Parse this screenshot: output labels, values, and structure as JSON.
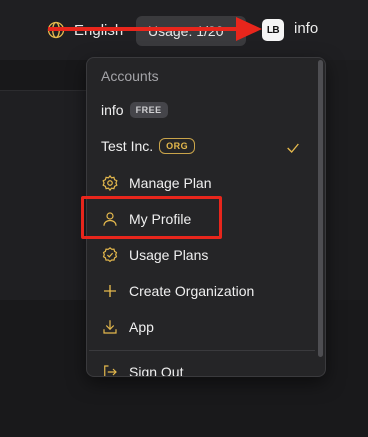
{
  "header": {
    "language_label": "English",
    "usage_label": "Usage: 1/20",
    "avatar_initials": "LB",
    "user_name": "info"
  },
  "menu": {
    "section_title": "Accounts",
    "accounts": [
      {
        "name": "info",
        "badge": "FREE"
      },
      {
        "name": "Test Inc.",
        "badge": "ORG",
        "selected": true
      }
    ],
    "items": [
      {
        "label": "Manage Plan",
        "icon": "gear-icon"
      },
      {
        "label": "My Profile",
        "icon": "user-icon"
      },
      {
        "label": "Usage Plans",
        "icon": "badge-check-icon"
      },
      {
        "label": "Create Organization",
        "icon": "plus-icon"
      },
      {
        "label": "App",
        "icon": "download-icon"
      },
      {
        "label": "Sign Out",
        "icon": "sign-out-icon"
      }
    ]
  },
  "colors": {
    "accent": "#e5b94d",
    "annotation_red": "#e8261c",
    "menu_bg": "#252527",
    "page_bg": "#1c1c1e"
  }
}
